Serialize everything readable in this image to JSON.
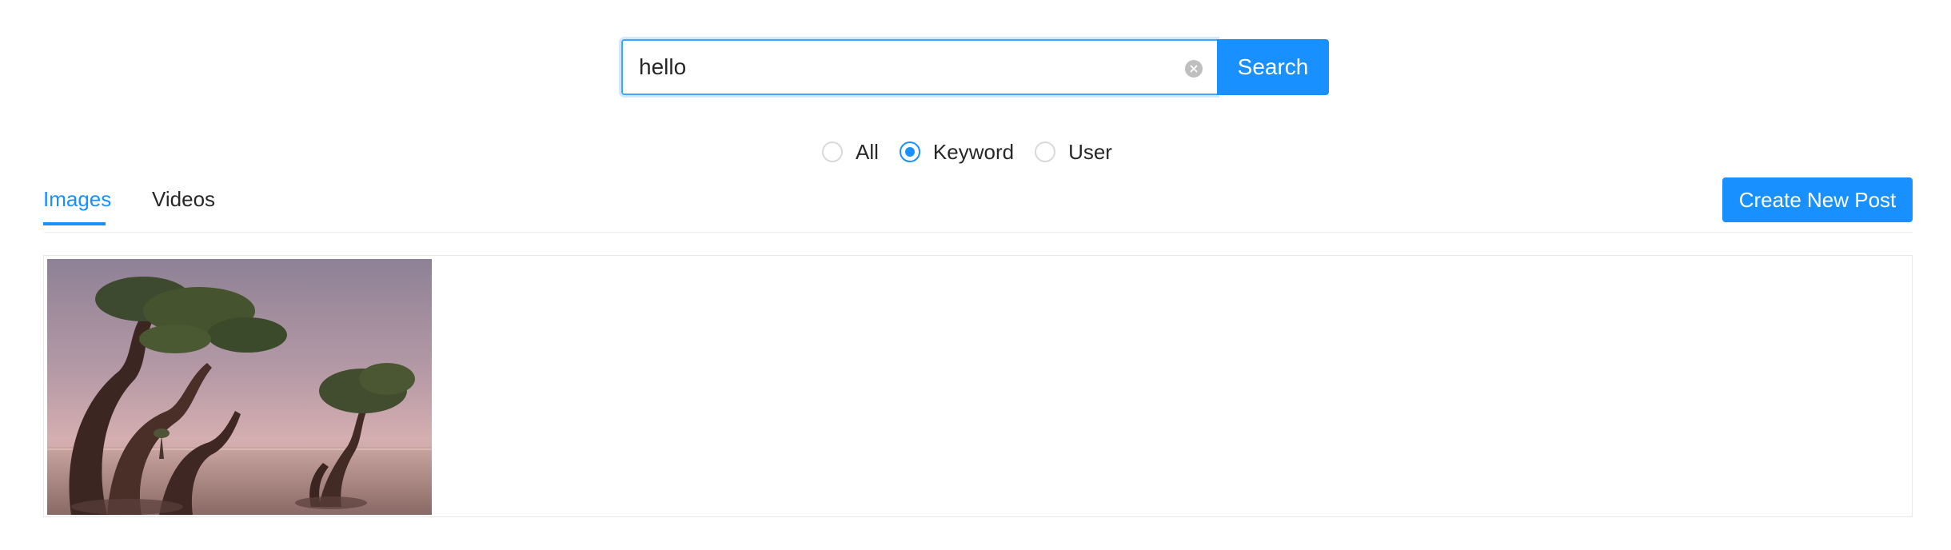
{
  "search": {
    "value": "hello",
    "button_label": "Search",
    "clear_icon": "close-circle-icon"
  },
  "search_type": {
    "options": [
      {
        "label": "All",
        "checked": false
      },
      {
        "label": "Keyword",
        "checked": true
      },
      {
        "label": "User",
        "checked": false
      }
    ]
  },
  "tabs": {
    "items": [
      {
        "label": "Images",
        "active": true
      },
      {
        "label": "Videos",
        "active": false
      }
    ]
  },
  "actions": {
    "create_label": "Create New Post"
  },
  "results": {
    "images": [
      {
        "subject": "mangrove trees at dusk"
      }
    ]
  },
  "colors": {
    "primary": "#1890ff",
    "border": "#d9d9d9",
    "text": "rgba(0,0,0,0.85)"
  }
}
